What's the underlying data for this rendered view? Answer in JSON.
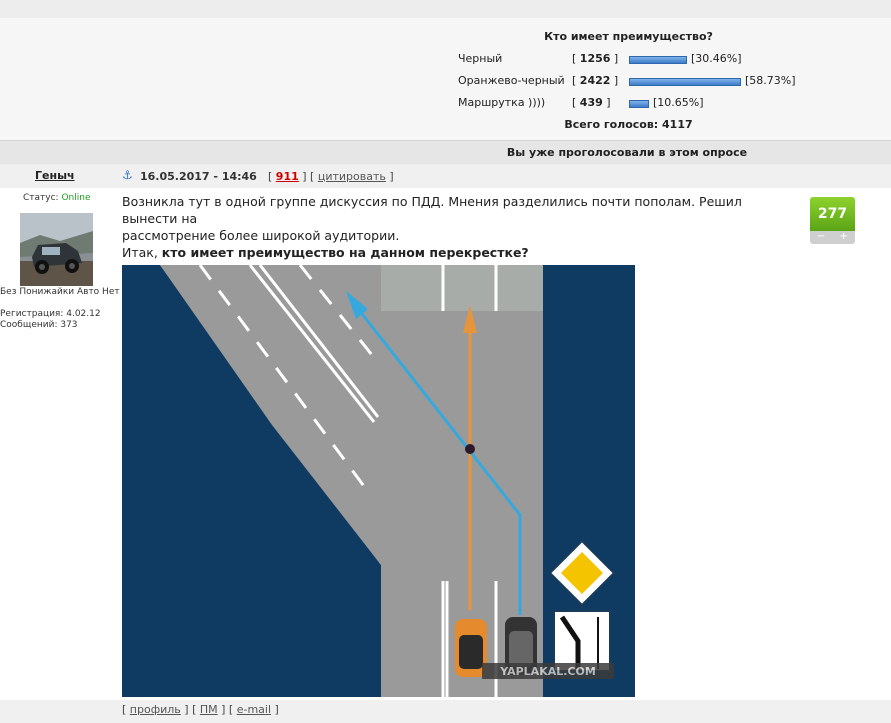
{
  "poll": {
    "question": "Кто имеет преимущество?",
    "options": [
      {
        "label": "Черный",
        "votes": "1256",
        "percent": "[30.46%]",
        "fraction": 0.3046
      },
      {
        "label": "Оранжево-черный",
        "votes": "2422",
        "percent": "[58.73%]",
        "fraction": 0.5873
      },
      {
        "label": "Маршрутка ))))",
        "votes": "439",
        "percent": "[10.65%]",
        "fraction": 0.1065
      }
    ],
    "total": "Всего голосов: 4117",
    "footer": "Вы уже проголосовали в этом опросе"
  },
  "post": {
    "author": "Геныч",
    "date": "16.05.2017 - 14:46",
    "post_number": "911",
    "quote_label": "цитировать",
    "status_label": "Статус:",
    "status_value": "Online",
    "user_title": "Без Понижайки Авто Нет",
    "registration": "Регистрация: 4.02.12",
    "messages": "Сообщений: 373",
    "text_line1": "Возникла тут в одной группе дискуссия по ПДД. Мнения разделились почти пополам. Решил вынести на",
    "text_line2": "рассмотрение более широкой аудитории.",
    "text_intro": "Итак, ",
    "text_bold": "кто имеет преимущество на данном перекрестке?",
    "rating": "277",
    "rating_minus": "−",
    "rating_plus": "+",
    "watermark": "YAPLAKAL.COM"
  },
  "footer_links": {
    "profile": "профиль",
    "pm": "ПМ",
    "email": "e-mail"
  },
  "colors": {
    "water": "#0f3b62",
    "road": "#9a9a9a",
    "blue_arrow": "#35a9de",
    "orange_arrow": "#e6953a",
    "rating_green": "#6bb51f"
  }
}
